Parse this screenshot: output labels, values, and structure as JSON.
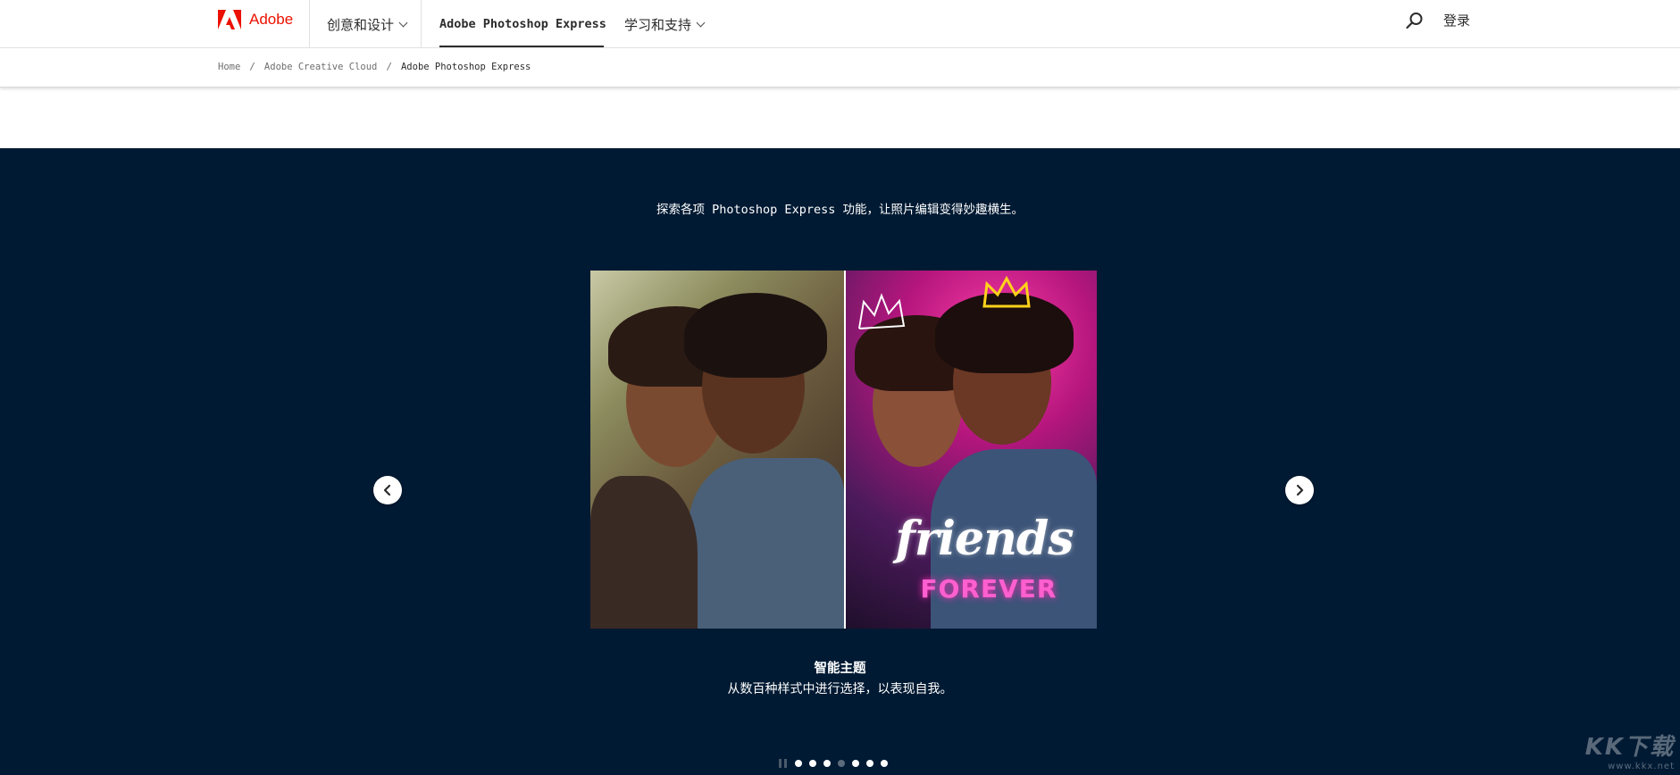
{
  "nav": {
    "brand": "Adobe",
    "items": [
      {
        "label": "创意和设计",
        "has_dropdown": true
      },
      {
        "label": "Adobe Photoshop Express",
        "has_dropdown": false,
        "active": true
      },
      {
        "label": "学习和支持",
        "has_dropdown": true
      }
    ],
    "signin_label": "登录",
    "search_icon": "search-icon"
  },
  "breadcrumb": {
    "items": [
      "Home",
      "Adobe Creative Cloud"
    ],
    "current": "Adobe Photoshop Express",
    "separator": "/"
  },
  "hero": {
    "intro": "探索各项 Photoshop Express 功能，让照片编辑变得妙趣横生。",
    "slide": {
      "overlay_title": "friends",
      "overlay_subtitle": "FOREVER",
      "caption_title": "智能主题",
      "caption_desc": "从数百种样式中进行选择，以表现自我。"
    },
    "prev_icon": "chevron-left-icon",
    "next_icon": "chevron-right-icon",
    "pagination": {
      "total": 7,
      "active_index": 3
    },
    "pause_icon": "pause-icon"
  },
  "watermark": {
    "big": "KK下载",
    "small": "www.kkx.net"
  },
  "colors": {
    "brand_red": "#eb1000",
    "dark_bg": "#001a33",
    "text": "#2c2c2c"
  }
}
